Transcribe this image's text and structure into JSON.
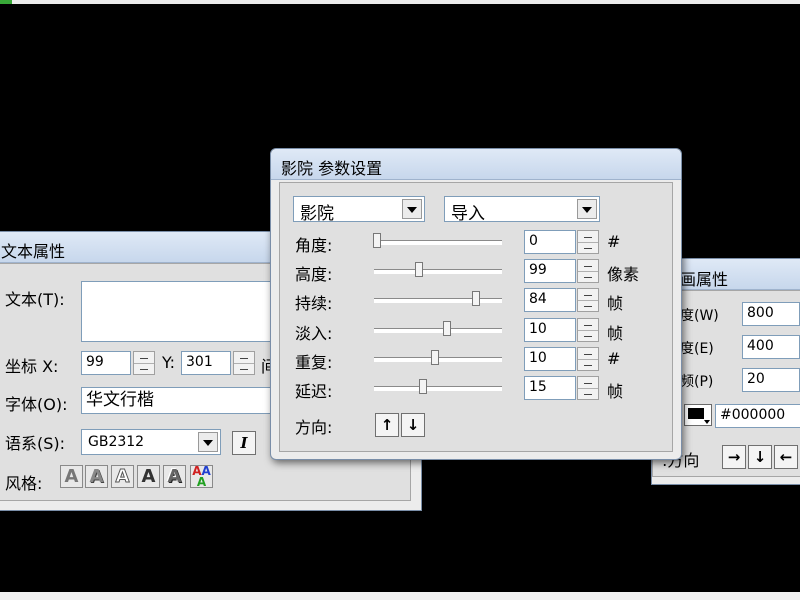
{
  "text_props": {
    "title": "文本属性",
    "text_label": "文本(T):",
    "coord_label": "坐标 X:",
    "x_value": "99",
    "y_label": "Y:",
    "y_value": "301",
    "clip_label": "间",
    "font_label": "字体(O):",
    "font_value": "华文行楷",
    "lang_label": "语系(S):",
    "lang_value": "GB2312",
    "italic_label": "I",
    "style_label": "风格:",
    "style_buttons": [
      "A",
      "A",
      "A",
      "A",
      "A",
      "A"
    ]
  },
  "shadow_dialog": {
    "title": "影院 参数设置",
    "effect_select": "影院",
    "mode_select": "导入",
    "rows": [
      {
        "label": "角度:",
        "value": "0",
        "unit": "#",
        "level": 0.02
      },
      {
        "label": "高度:",
        "value": "99",
        "unit": "像素",
        "level": 0.35
      },
      {
        "label": "持续:",
        "value": "84",
        "unit": "帧",
        "level": 0.8
      },
      {
        "label": "淡入:",
        "value": "10",
        "unit": "帧",
        "level": 0.57
      },
      {
        "label": "重复:",
        "value": "10",
        "unit": "#",
        "level": 0.48
      },
      {
        "label": "延迟:",
        "value": "15",
        "unit": "帧",
        "level": 0.38
      }
    ],
    "direction_label": "方向:",
    "direction_buttons": [
      "↑",
      "↓"
    ]
  },
  "canvas_props": {
    "title": "画属性",
    "width_label": "宽度(W)",
    "width_value": "800",
    "height_label": "高度(E)",
    "height_value": "400",
    "fps_label": "帧频(P)",
    "fps_value": "20",
    "bg_color_value": "#000000",
    "bg_color": "#000000",
    "direction_label": "方向:",
    "direction_buttons": [
      "→",
      "↓",
      "←"
    ]
  }
}
